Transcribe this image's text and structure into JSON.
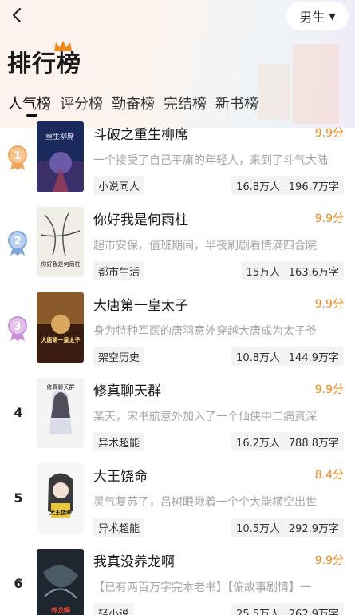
{
  "header": {
    "title": "排行榜",
    "gender": "男生"
  },
  "tabs": [
    "人气榜",
    "评分榜",
    "勤奋榜",
    "完结榜",
    "新书榜"
  ],
  "books": [
    {
      "rank": "1",
      "title": "斗破之重生柳席",
      "score": "9.9分",
      "desc": "一个接受了自己平庸的年轻人，来到了斗气大陆",
      "genre": "小说同人",
      "readers": "16.8万人",
      "words": "196.7万字",
      "cover_text": "重生柳席"
    },
    {
      "rank": "2",
      "title": "你好我是何雨柱",
      "score": "9.9分",
      "desc": "超市安保，值班期间，半夜刷剧看情满四合院",
      "genre": "都市生活",
      "readers": "15万人",
      "words": "163.6万字",
      "cover_text": "你好我是何雨柱"
    },
    {
      "rank": "3",
      "title": "大唐第一皇太子",
      "score": "9.9分",
      "desc": "身为特种军医的唐羽意外穿越大唐成为太子爷",
      "genre": "架空历史",
      "readers": "10.8万人",
      "words": "144.9万字",
      "cover_text": "大唐第一皇太子"
    },
    {
      "rank": "4",
      "title": "修真聊天群",
      "score": "9.9分",
      "desc": "某天，宋书航意外加入了一个仙侠中二病资深",
      "genre": "异术超能",
      "readers": "16.2万人",
      "words": "788.8万字",
      "cover_text": "修真聊天群"
    },
    {
      "rank": "5",
      "title": "大王饶命",
      "score": "8.4分",
      "desc": "灵气复苏了，吕树眼瞅着一个个大能横空出世",
      "genre": "异术超能",
      "readers": "10.5万人",
      "words": "292.9万字",
      "cover_text": "大王饶命"
    },
    {
      "rank": "6",
      "title": "我真没养龙啊",
      "score": "9.9分",
      "desc": "【已有两百万字完本老书】【偏故事剧情】一",
      "genre": "轻小说",
      "readers": "25.5万人",
      "words": "262.9万字",
      "cover_text": "养龙啊"
    }
  ],
  "colors": {
    "accent": "#f08a1e",
    "medal_gold": "#f2a55a",
    "medal_silver": "#7fa6d8",
    "medal_bronze": "#c98fd6"
  }
}
